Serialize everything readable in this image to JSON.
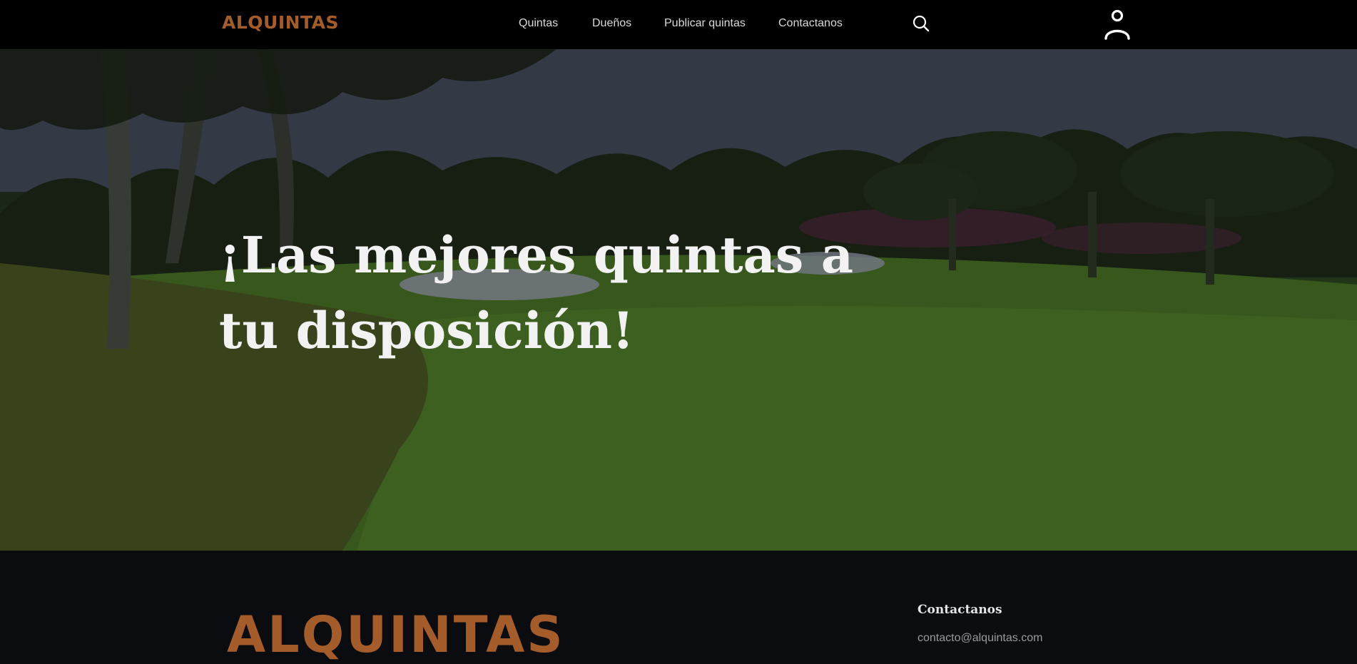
{
  "header": {
    "logo_text": "ALQUINTAS",
    "nav": [
      {
        "label": "Quintas"
      },
      {
        "label": "Dueños"
      },
      {
        "label": "Publicar quintas"
      },
      {
        "label": "Contactanos"
      }
    ],
    "search_icon": "search-icon",
    "user_icon": "user-icon"
  },
  "hero": {
    "title": "¡Las mejores quintas a tu disposición!"
  },
  "footer": {
    "logo_text": "ALQUINTAS",
    "contact_title": "Contactanos",
    "contact_email": "contacto@alquintas.com"
  },
  "colors": {
    "brand": "#a45c2a",
    "header_bg": "#000000",
    "footer_bg": "#0b0c0f"
  }
}
